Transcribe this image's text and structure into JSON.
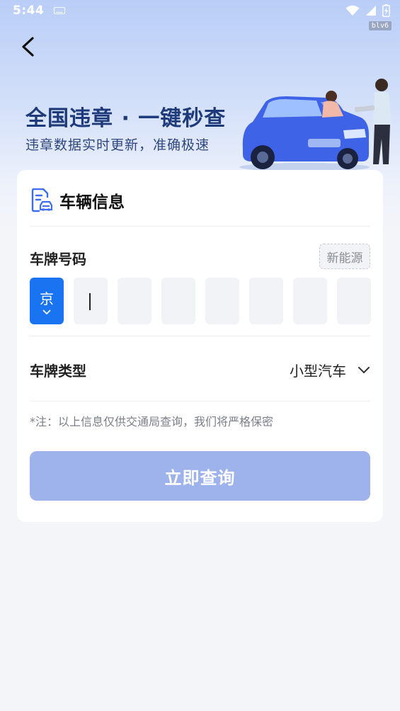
{
  "status": {
    "time": "5:44",
    "build": "blv6"
  },
  "hero": {
    "title": "全国违章 · 一键秒查",
    "subtitle": "违章数据实时更新，准确极速"
  },
  "card": {
    "title": "车辆信息",
    "plate": {
      "label": "车牌号码",
      "new_energy": "新能源",
      "province": "京",
      "chars": [
        "",
        "",
        "",
        "",
        "",
        "",
        ""
      ]
    },
    "plate_type": {
      "label": "车牌类型",
      "value": "小型汽车"
    },
    "note": "*注：以上信息仅供交通局查询，我们将严格保密",
    "submit": "立即查询"
  },
  "colors": {
    "accent": "#1a73f0",
    "button_disabled": "#9eb2eb",
    "title_blue": "#1e3a7a"
  }
}
